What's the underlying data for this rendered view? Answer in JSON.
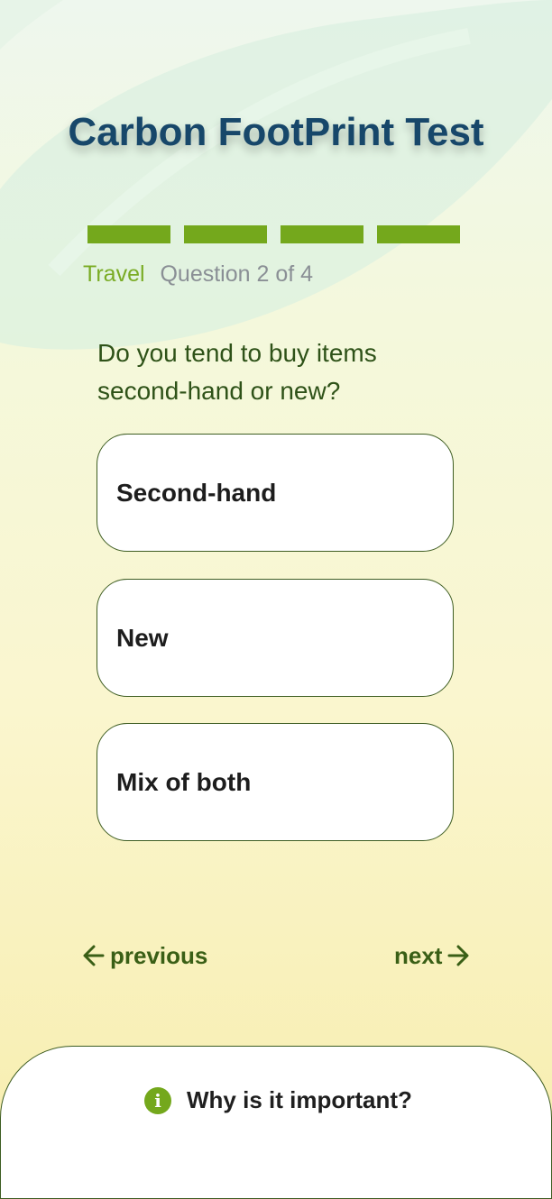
{
  "header": {
    "title": "Carbon FootPrint Test"
  },
  "progress": {
    "segments_total": 4,
    "segments_filled": 4,
    "color": "#74a81c"
  },
  "meta": {
    "category": "Travel",
    "question_counter": "Question 2 of 4"
  },
  "question": {
    "text": "Do you tend to buy items second-hand or new?"
  },
  "options": [
    {
      "label": "Second-hand"
    },
    {
      "label": "New"
    },
    {
      "label": "Mix of both"
    }
  ],
  "navigation": {
    "previous_label": "previous",
    "next_label": "next"
  },
  "info_panel": {
    "icon": "info-icon",
    "label": "Why is it important?"
  },
  "colors": {
    "title": "#17476a",
    "accent_green": "#74a81c",
    "dark_green": "#3a5f16",
    "muted_gray": "#8a8f95"
  }
}
